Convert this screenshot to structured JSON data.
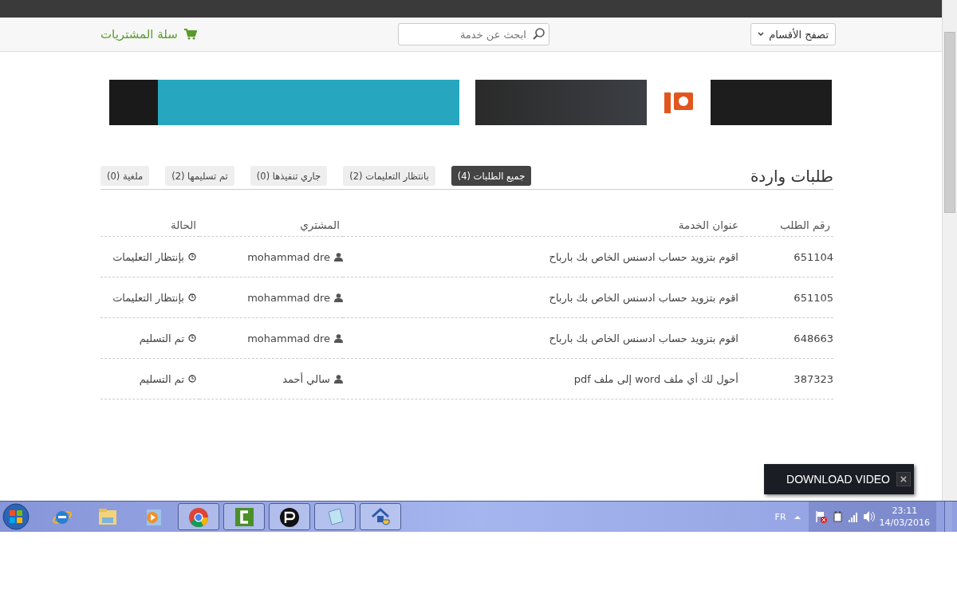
{
  "toolbar": {
    "categories": {
      "label": "تصفح الأقسام"
    },
    "search": {
      "placeholder": "ابحث عن خدمة"
    },
    "cart": {
      "label": "سلة المشتريات"
    }
  },
  "page_title": "طلبات واردة",
  "filters": [
    {
      "label": "جميع الطلبات (4)",
      "selected": true
    },
    {
      "label": "بانتظار التعليمات (2)",
      "selected": false
    },
    {
      "label": "جاري تنفيذها (0)",
      "selected": false
    },
    {
      "label": "تم تسليمها (2)",
      "selected": false
    },
    {
      "label": "ملغية (0)",
      "selected": false
    }
  ],
  "table": {
    "columns": [
      "رقم الطلب",
      "عنوان الخدمة",
      "المشتري",
      "الحالة"
    ],
    "rows": [
      {
        "id": "651104",
        "service": "اقوم بتزويد حساب ادسنس الخاص بك بارباح",
        "buyer": "mohammad dre",
        "status": "بإنتظار التعليمات"
      },
      {
        "id": "651105",
        "service": "اقوم بتزويد حساب ادسنس الخاص بك بارباح",
        "buyer": "mohammad dre",
        "status": "بإنتظار التعليمات"
      },
      {
        "id": "648663",
        "service": "اقوم بتزويد حساب ادسنس الخاص بك بارباح",
        "buyer": "mohammad dre",
        "status": "تم التسليم"
      },
      {
        "id": "387323",
        "service": "أحول لك أي ملف word إلى ملف pdf",
        "buyer": "سالي أحمد",
        "status": "تم التسليم"
      }
    ]
  },
  "video_popup": {
    "label": "DOWNLOAD VIDEO",
    "close": "×"
  },
  "taskbar": {
    "apps": [
      {
        "kind": "browser-e",
        "running": false
      },
      {
        "kind": "folder",
        "running": false
      },
      {
        "kind": "player",
        "running": false
      },
      {
        "kind": "chrome",
        "running": true
      },
      {
        "kind": "recorder",
        "running": true
      },
      {
        "kind": "chat",
        "running": true
      },
      {
        "kind": "notepad",
        "running": true
      },
      {
        "kind": "tool",
        "running": true
      }
    ],
    "language": "FR",
    "time": "23:11",
    "date": "14/03/2016"
  }
}
